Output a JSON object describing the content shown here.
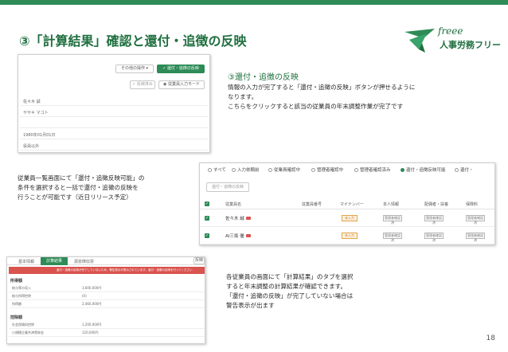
{
  "slide": {
    "title": "③「計算結果」確認と還付・追徴の反映",
    "page_number": "18",
    "accent_color": "#2e8b57"
  },
  "logo": {
    "script": "freee",
    "name": "人事労務フリー"
  },
  "screenshot1": {
    "dropdown_label": "その他の操作 ▾",
    "reflect_button": "還付・追徴の反映",
    "saved_label": "✓ 反映済み",
    "input_mode_button": "従業員入力モード",
    "fields": [
      "佐々木 誠",
      "ササキ マコト",
      "",
      "1980年01月01日",
      "役員以外"
    ]
  },
  "callout_top": {
    "heading": "③還付・追徴の反映",
    "lines": [
      "情報の入力が完了すると「還付・追徴の反映」ボタンが押せるように",
      "なります。",
      "こちらをクリックすると該当の従業員の年末調整作業が完了です"
    ]
  },
  "callout_left": {
    "lines": [
      "従業員一覧画面にて「還付・追徴反映可能」の",
      "条件を選択すると一括で還付・追徴の反映を",
      "行うことが可能です（近日リリース予定）"
    ]
  },
  "screenshot2": {
    "filters": [
      "すべて",
      "入力依頼前",
      "従業員確認中",
      "管理者確認中",
      "管理者確認済み",
      "還付・追徴反映可能",
      "還付・"
    ],
    "selected_filter": "還付・追徴反映可能",
    "bulk_button": "還付・追徴の反映",
    "columns": [
      "従業員名",
      "従業員番号",
      "マイナンバー",
      "本人情報",
      "配偶者・扶養",
      "保険料"
    ],
    "rows": [
      {
        "name": "佐々木 誠",
        "mynumber": "未入力",
        "self": "管理者確認済",
        "spouse": "管理者確認済",
        "insurance": "管理者確認済"
      },
      {
        "name": "AI三坂 優",
        "mynumber": "未入力",
        "self": "管理者確認済",
        "spouse": "管理者確認済",
        "insurance": "管理者確認済"
      }
    ]
  },
  "screenshot3": {
    "tabs": [
      "基本情報",
      "計算結果",
      "源泉徴収票"
    ],
    "active_tab": "計算結果",
    "action_label": "反映",
    "warning": "還付・追徴の反映が完了していないため、警告表示が表示されています。還付・追徴の反映を行ってください",
    "sections": [
      {
        "title": "所得額",
        "rows": [
          {
            "label": "給与等の収入",
            "value": "3,600,000円"
          },
          {
            "label": "給与所得控除",
            "value": "(0)"
          },
          {
            "label": "所得額",
            "value": "2,460,000円"
          }
        ]
      },
      {
        "title": "控除額",
        "rows": [
          {
            "label": "社会保険料控除",
            "value": "1,200,000円"
          },
          {
            "label": "小規模企業共済等掛金",
            "value": "120,000円"
          }
        ]
      }
    ]
  },
  "callout_bottom": {
    "lines": [
      "各従業員の画面にて「計算結果」のタブを選択",
      "すると年末調整の計算結果が確認できます。",
      "「還付・追徴の反映」が完了していない場合は",
      "警告表示が出ます"
    ]
  }
}
